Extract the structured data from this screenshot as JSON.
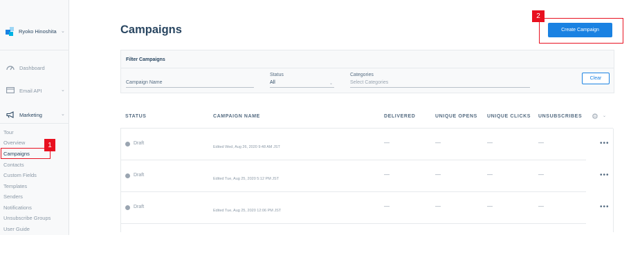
{
  "sidebar": {
    "account_name": "Ryoko Hinoshita",
    "nav": [
      {
        "label": "Dashboard",
        "icon": "gauge-icon"
      },
      {
        "label": "Email API",
        "icon": "email-icon"
      },
      {
        "label": "Marketing",
        "icon": "megaphone-icon"
      }
    ],
    "sub_items": [
      "Tour",
      "Overview",
      "Campaigns",
      "Contacts",
      "Custom Fields",
      "Templates",
      "Senders",
      "Notifications",
      "Unsubscribe Groups",
      "User Guide"
    ]
  },
  "header": {
    "title": "Campaigns",
    "create_label": "Create Campaign"
  },
  "filter": {
    "title": "Filter Campaigns",
    "campaign_name_placeholder": "Campaign Name",
    "status_label": "Status",
    "status_value": "All",
    "categories_label": "Categories",
    "categories_placeholder": "Select Categories",
    "clear_label": "Clear"
  },
  "table": {
    "columns": [
      "STATUS",
      "CAMPAIGN NAME",
      "DELIVERED",
      "UNIQUE OPENS",
      "UNIQUE CLICKS",
      "UNSUBSCRIBES"
    ],
    "rows": [
      {
        "status": "Draft",
        "edited": "Edited Wed, Aug 26, 2020 9:48 AM JST",
        "delivered": "—",
        "opens": "—",
        "clicks": "—",
        "unsubs": "—",
        "more": "•••"
      },
      {
        "status": "Draft",
        "edited": "Edited Tue, Aug 25, 2020 5:12 PM JST",
        "delivered": "—",
        "opens": "—",
        "clicks": "—",
        "unsubs": "—",
        "more": "•••"
      },
      {
        "status": "Draft",
        "edited": "Edited Tue, Aug 25, 2020 12:06 PM JST",
        "delivered": "—",
        "opens": "—",
        "clicks": "—",
        "unsubs": "—",
        "more": "•••"
      }
    ]
  },
  "annotations": [
    {
      "number": "1"
    },
    {
      "number": "2"
    }
  ],
  "colors": {
    "accent": "#1a82e2",
    "annotation": "#e8101f",
    "text": "#294661"
  }
}
